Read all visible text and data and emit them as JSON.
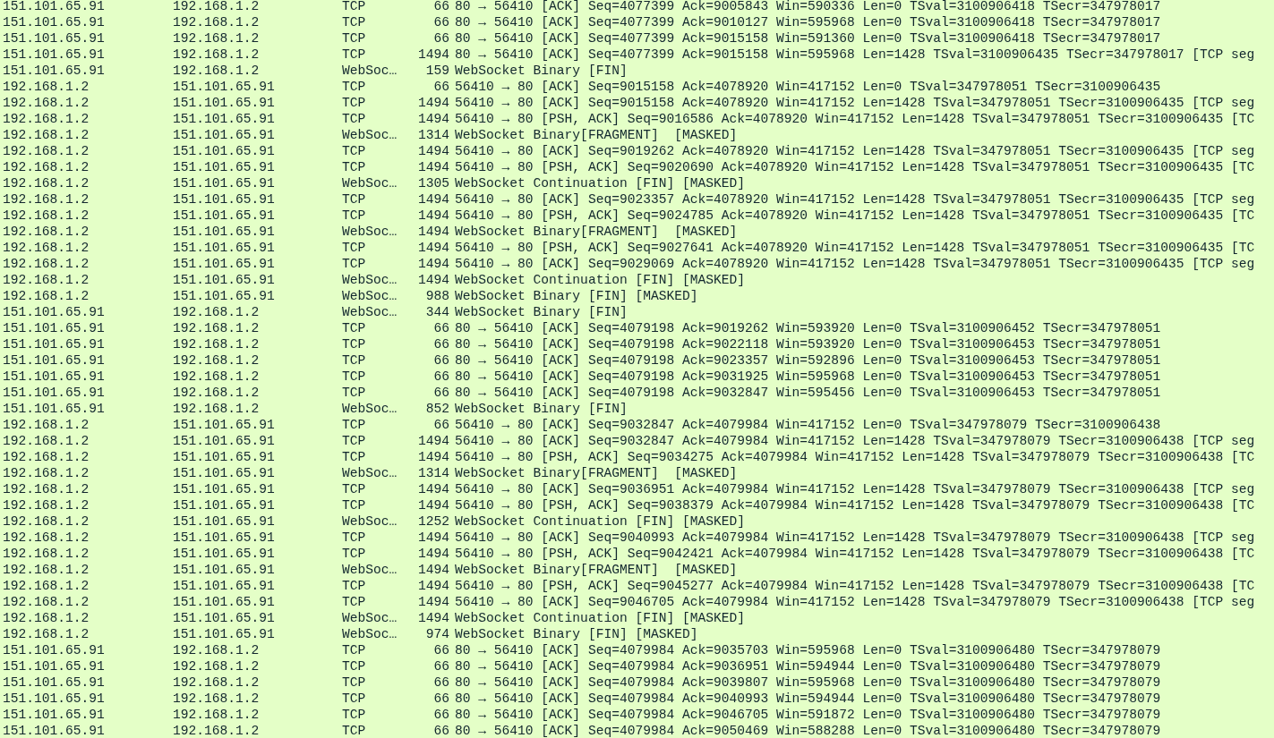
{
  "packet_list": {
    "rows": [
      {
        "source": "151.101.65.91",
        "destination": "192.168.1.2",
        "protocol": "TCP",
        "length": "66",
        "info": "80 → 56410 [ACK] Seq=4077399 Ack=9005843 Win=590336 Len=0 TSval=3100906418 TSecr=347978017"
      },
      {
        "source": "151.101.65.91",
        "destination": "192.168.1.2",
        "protocol": "TCP",
        "length": "66",
        "info": "80 → 56410 [ACK] Seq=4077399 Ack=9010127 Win=595968 Len=0 TSval=3100906418 TSecr=347978017"
      },
      {
        "source": "151.101.65.91",
        "destination": "192.168.1.2",
        "protocol": "TCP",
        "length": "66",
        "info": "80 → 56410 [ACK] Seq=4077399 Ack=9015158 Win=591360 Len=0 TSval=3100906418 TSecr=347978017"
      },
      {
        "source": "151.101.65.91",
        "destination": "192.168.1.2",
        "protocol": "TCP",
        "length": "1494",
        "info": "80 → 56410 [ACK] Seq=4077399 Ack=9015158 Win=595968 Len=1428 TSval=3100906435 TSecr=347978017 [TCP seg"
      },
      {
        "source": "151.101.65.91",
        "destination": "192.168.1.2",
        "protocol": "WebSoc…",
        "length": "159",
        "info": "WebSocket Binary [FIN]"
      },
      {
        "source": "192.168.1.2",
        "destination": "151.101.65.91",
        "protocol": "TCP",
        "length": "66",
        "info": "56410 → 80 [ACK] Seq=9015158 Ack=4078920 Win=417152 Len=0 TSval=347978051 TSecr=3100906435"
      },
      {
        "source": "192.168.1.2",
        "destination": "151.101.65.91",
        "protocol": "TCP",
        "length": "1494",
        "info": "56410 → 80 [ACK] Seq=9015158 Ack=4078920 Win=417152 Len=1428 TSval=347978051 TSecr=3100906435 [TCP seg"
      },
      {
        "source": "192.168.1.2",
        "destination": "151.101.65.91",
        "protocol": "TCP",
        "length": "1494",
        "info": "56410 → 80 [PSH, ACK] Seq=9016586 Ack=4078920 Win=417152 Len=1428 TSval=347978051 TSecr=3100906435 [TC"
      },
      {
        "source": "192.168.1.2",
        "destination": "151.101.65.91",
        "protocol": "WebSoc…",
        "length": "1314",
        "info": "WebSocket Binary[FRAGMENT]  [MASKED]"
      },
      {
        "source": "192.168.1.2",
        "destination": "151.101.65.91",
        "protocol": "TCP",
        "length": "1494",
        "info": "56410 → 80 [ACK] Seq=9019262 Ack=4078920 Win=417152 Len=1428 TSval=347978051 TSecr=3100906435 [TCP seg"
      },
      {
        "source": "192.168.1.2",
        "destination": "151.101.65.91",
        "protocol": "TCP",
        "length": "1494",
        "info": "56410 → 80 [PSH, ACK] Seq=9020690 Ack=4078920 Win=417152 Len=1428 TSval=347978051 TSecr=3100906435 [TC"
      },
      {
        "source": "192.168.1.2",
        "destination": "151.101.65.91",
        "protocol": "WebSoc…",
        "length": "1305",
        "info": "WebSocket Continuation [FIN] [MASKED]"
      },
      {
        "source": "192.168.1.2",
        "destination": "151.101.65.91",
        "protocol": "TCP",
        "length": "1494",
        "info": "56410 → 80 [ACK] Seq=9023357 Ack=4078920 Win=417152 Len=1428 TSval=347978051 TSecr=3100906435 [TCP seg"
      },
      {
        "source": "192.168.1.2",
        "destination": "151.101.65.91",
        "protocol": "TCP",
        "length": "1494",
        "info": "56410 → 80 [PSH, ACK] Seq=9024785 Ack=4078920 Win=417152 Len=1428 TSval=347978051 TSecr=3100906435 [TC"
      },
      {
        "source": "192.168.1.2",
        "destination": "151.101.65.91",
        "protocol": "WebSoc…",
        "length": "1494",
        "info": "WebSocket Binary[FRAGMENT]  [MASKED]"
      },
      {
        "source": "192.168.1.2",
        "destination": "151.101.65.91",
        "protocol": "TCP",
        "length": "1494",
        "info": "56410 → 80 [PSH, ACK] Seq=9027641 Ack=4078920 Win=417152 Len=1428 TSval=347978051 TSecr=3100906435 [TC"
      },
      {
        "source": "192.168.1.2",
        "destination": "151.101.65.91",
        "protocol": "TCP",
        "length": "1494",
        "info": "56410 → 80 [ACK] Seq=9029069 Ack=4078920 Win=417152 Len=1428 TSval=347978051 TSecr=3100906435 [TCP seg"
      },
      {
        "source": "192.168.1.2",
        "destination": "151.101.65.91",
        "protocol": "WebSoc…",
        "length": "1494",
        "info": "WebSocket Continuation [FIN] [MASKED]"
      },
      {
        "source": "192.168.1.2",
        "destination": "151.101.65.91",
        "protocol": "WebSoc…",
        "length": "988",
        "info": "WebSocket Binary [FIN] [MASKED]"
      },
      {
        "source": "151.101.65.91",
        "destination": "192.168.1.2",
        "protocol": "WebSoc…",
        "length": "344",
        "info": "WebSocket Binary [FIN]"
      },
      {
        "source": "151.101.65.91",
        "destination": "192.168.1.2",
        "protocol": "TCP",
        "length": "66",
        "info": "80 → 56410 [ACK] Seq=4079198 Ack=9019262 Win=593920 Len=0 TSval=3100906452 TSecr=347978051"
      },
      {
        "source": "151.101.65.91",
        "destination": "192.168.1.2",
        "protocol": "TCP",
        "length": "66",
        "info": "80 → 56410 [ACK] Seq=4079198 Ack=9022118 Win=593920 Len=0 TSval=3100906453 TSecr=347978051"
      },
      {
        "source": "151.101.65.91",
        "destination": "192.168.1.2",
        "protocol": "TCP",
        "length": "66",
        "info": "80 → 56410 [ACK] Seq=4079198 Ack=9023357 Win=592896 Len=0 TSval=3100906453 TSecr=347978051"
      },
      {
        "source": "151.101.65.91",
        "destination": "192.168.1.2",
        "protocol": "TCP",
        "length": "66",
        "info": "80 → 56410 [ACK] Seq=4079198 Ack=9031925 Win=595968 Len=0 TSval=3100906453 TSecr=347978051"
      },
      {
        "source": "151.101.65.91",
        "destination": "192.168.1.2",
        "protocol": "TCP",
        "length": "66",
        "info": "80 → 56410 [ACK] Seq=4079198 Ack=9032847 Win=595456 Len=0 TSval=3100906453 TSecr=347978051"
      },
      {
        "source": "151.101.65.91",
        "destination": "192.168.1.2",
        "protocol": "WebSoc…",
        "length": "852",
        "info": "WebSocket Binary [FIN]"
      },
      {
        "source": "192.168.1.2",
        "destination": "151.101.65.91",
        "protocol": "TCP",
        "length": "66",
        "info": "56410 → 80 [ACK] Seq=9032847 Ack=4079984 Win=417152 Len=0 TSval=347978079 TSecr=3100906438"
      },
      {
        "source": "192.168.1.2",
        "destination": "151.101.65.91",
        "protocol": "TCP",
        "length": "1494",
        "info": "56410 → 80 [ACK] Seq=9032847 Ack=4079984 Win=417152 Len=1428 TSval=347978079 TSecr=3100906438 [TCP seg"
      },
      {
        "source": "192.168.1.2",
        "destination": "151.101.65.91",
        "protocol": "TCP",
        "length": "1494",
        "info": "56410 → 80 [PSH, ACK] Seq=9034275 Ack=4079984 Win=417152 Len=1428 TSval=347978079 TSecr=3100906438 [TC"
      },
      {
        "source": "192.168.1.2",
        "destination": "151.101.65.91",
        "protocol": "WebSoc…",
        "length": "1314",
        "info": "WebSocket Binary[FRAGMENT]  [MASKED]"
      },
      {
        "source": "192.168.1.2",
        "destination": "151.101.65.91",
        "protocol": "TCP",
        "length": "1494",
        "info": "56410 → 80 [ACK] Seq=9036951 Ack=4079984 Win=417152 Len=1428 TSval=347978079 TSecr=3100906438 [TCP seg"
      },
      {
        "source": "192.168.1.2",
        "destination": "151.101.65.91",
        "protocol": "TCP",
        "length": "1494",
        "info": "56410 → 80 [PSH, ACK] Seq=9038379 Ack=4079984 Win=417152 Len=1428 TSval=347978079 TSecr=3100906438 [TC"
      },
      {
        "source": "192.168.1.2",
        "destination": "151.101.65.91",
        "protocol": "WebSoc…",
        "length": "1252",
        "info": "WebSocket Continuation [FIN] [MASKED]"
      },
      {
        "source": "192.168.1.2",
        "destination": "151.101.65.91",
        "protocol": "TCP",
        "length": "1494",
        "info": "56410 → 80 [ACK] Seq=9040993 Ack=4079984 Win=417152 Len=1428 TSval=347978079 TSecr=3100906438 [TCP seg"
      },
      {
        "source": "192.168.1.2",
        "destination": "151.101.65.91",
        "protocol": "TCP",
        "length": "1494",
        "info": "56410 → 80 [PSH, ACK] Seq=9042421 Ack=4079984 Win=417152 Len=1428 TSval=347978079 TSecr=3100906438 [TC"
      },
      {
        "source": "192.168.1.2",
        "destination": "151.101.65.91",
        "protocol": "WebSoc…",
        "length": "1494",
        "info": "WebSocket Binary[FRAGMENT]  [MASKED]"
      },
      {
        "source": "192.168.1.2",
        "destination": "151.101.65.91",
        "protocol": "TCP",
        "length": "1494",
        "info": "56410 → 80 [PSH, ACK] Seq=9045277 Ack=4079984 Win=417152 Len=1428 TSval=347978079 TSecr=3100906438 [TC"
      },
      {
        "source": "192.168.1.2",
        "destination": "151.101.65.91",
        "protocol": "TCP",
        "length": "1494",
        "info": "56410 → 80 [ACK] Seq=9046705 Ack=4079984 Win=417152 Len=1428 TSval=347978079 TSecr=3100906438 [TCP seg"
      },
      {
        "source": "192.168.1.2",
        "destination": "151.101.65.91",
        "protocol": "WebSoc…",
        "length": "1494",
        "info": "WebSocket Continuation [FIN] [MASKED]"
      },
      {
        "source": "192.168.1.2",
        "destination": "151.101.65.91",
        "protocol": "WebSoc…",
        "length": "974",
        "info": "WebSocket Binary [FIN] [MASKED]"
      },
      {
        "source": "151.101.65.91",
        "destination": "192.168.1.2",
        "protocol": "TCP",
        "length": "66",
        "info": "80 → 56410 [ACK] Seq=4079984 Ack=9035703 Win=595968 Len=0 TSval=3100906480 TSecr=347978079"
      },
      {
        "source": "151.101.65.91",
        "destination": "192.168.1.2",
        "protocol": "TCP",
        "length": "66",
        "info": "80 → 56410 [ACK] Seq=4079984 Ack=9036951 Win=594944 Len=0 TSval=3100906480 TSecr=347978079"
      },
      {
        "source": "151.101.65.91",
        "destination": "192.168.1.2",
        "protocol": "TCP",
        "length": "66",
        "info": "80 → 56410 [ACK] Seq=4079984 Ack=9039807 Win=595968 Len=0 TSval=3100906480 TSecr=347978079"
      },
      {
        "source": "151.101.65.91",
        "destination": "192.168.1.2",
        "protocol": "TCP",
        "length": "66",
        "info": "80 → 56410 [ACK] Seq=4079984 Ack=9040993 Win=594944 Len=0 TSval=3100906480 TSecr=347978079"
      },
      {
        "source": "151.101.65.91",
        "destination": "192.168.1.2",
        "protocol": "TCP",
        "length": "66",
        "info": "80 → 56410 [ACK] Seq=4079984 Ack=9046705 Win=591872 Len=0 TSval=3100906480 TSecr=347978079"
      },
      {
        "source": "151.101.65.91",
        "destination": "192.168.1.2",
        "protocol": "TCP",
        "length": "66",
        "info": "80 → 56410 [ACK] Seq=4079984 Ack=9050469 Win=588288 Len=0 TSval=3100906480 TSecr=347978079"
      }
    ]
  }
}
